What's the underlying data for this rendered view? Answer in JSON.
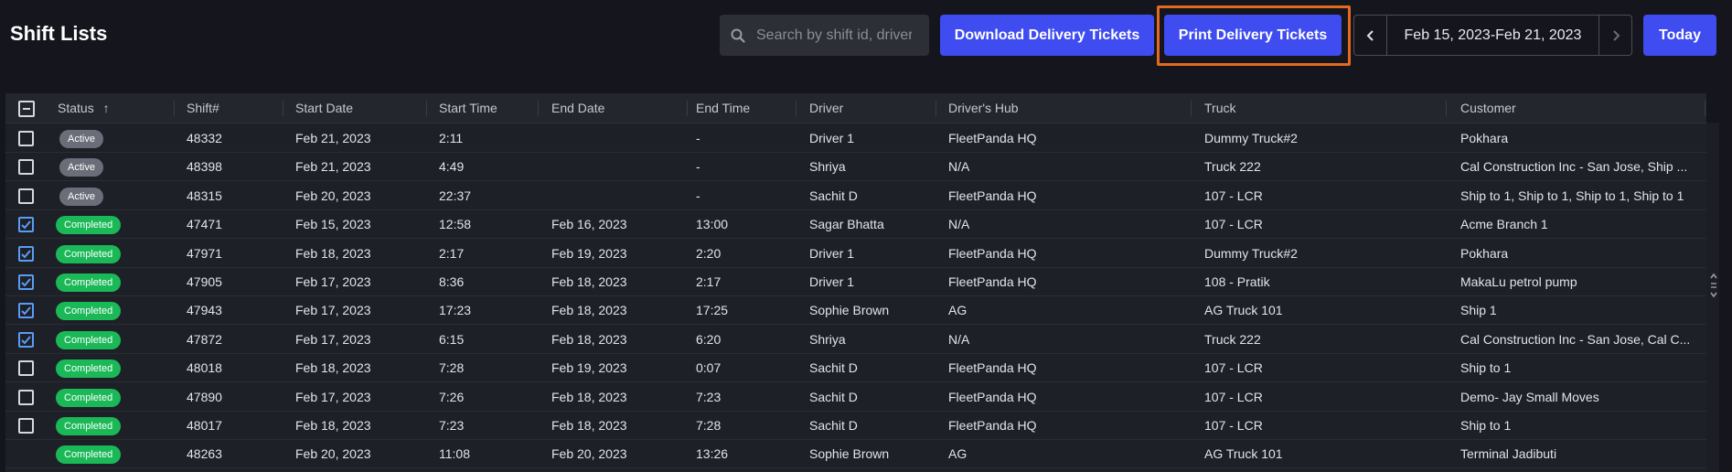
{
  "header": {
    "title": "Shift Lists",
    "search_placeholder": "Search by shift id, driver",
    "download_label": "Download Delivery Tickets",
    "print_label": "Print Delivery Tickets",
    "date_range": "Feb 15, 2023-Feb 21, 2023",
    "today_label": "Today"
  },
  "columns": [
    "Status",
    "Shift#",
    "Start Date",
    "Start Time",
    "End Date",
    "End Time",
    "Driver",
    "Driver's Hub",
    "Truck",
    "Customer"
  ],
  "sort_indicator": "↑",
  "colors": {
    "accent": "#3e4cf0",
    "highlight": "#e36a1f",
    "active_badge": "#6b6e78",
    "completed_badge": "#1bb858"
  },
  "rows": [
    {
      "checked": false,
      "status": "Active",
      "shift": "48332",
      "start_date": "Feb 21, 2023",
      "start_time": "2:11",
      "end_date": "",
      "end_time": "-",
      "driver": "Driver 1",
      "hub": "FleetPanda HQ",
      "truck": "Dummy Truck#2",
      "customer": "Pokhara"
    },
    {
      "checked": false,
      "status": "Active",
      "shift": "48398",
      "start_date": "Feb 21, 2023",
      "start_time": "4:49",
      "end_date": "",
      "end_time": "-",
      "driver": "Shriya",
      "hub": "N/A",
      "truck": "Truck 222",
      "customer": "Cal Construction Inc - San Jose, Ship ..."
    },
    {
      "checked": false,
      "status": "Active",
      "shift": "48315",
      "start_date": "Feb 20, 2023",
      "start_time": "22:37",
      "end_date": "",
      "end_time": "-",
      "driver": "Sachit D",
      "hub": "FleetPanda HQ",
      "truck": "107 - LCR",
      "customer": "Ship to 1, Ship to 1, Ship to 1, Ship to 1"
    },
    {
      "checked": true,
      "status": "Completed",
      "shift": "47471",
      "start_date": "Feb 15, 2023",
      "start_time": "12:58",
      "end_date": "Feb 16, 2023",
      "end_time": "13:00",
      "driver": "Sagar Bhatta",
      "hub": "N/A",
      "truck": "107 - LCR",
      "customer": "Acme Branch 1"
    },
    {
      "checked": true,
      "status": "Completed",
      "shift": "47971",
      "start_date": "Feb 18, 2023",
      "start_time": "2:17",
      "end_date": "Feb 19, 2023",
      "end_time": "2:20",
      "driver": "Driver 1",
      "hub": "FleetPanda HQ",
      "truck": "Dummy Truck#2",
      "customer": "Pokhara"
    },
    {
      "checked": true,
      "status": "Completed",
      "shift": "47905",
      "start_date": "Feb 17, 2023",
      "start_time": "8:36",
      "end_date": "Feb 18, 2023",
      "end_time": "2:17",
      "driver": "Driver 1",
      "hub": "FleetPanda HQ",
      "truck": "108 - Pratik",
      "customer": "MakaLu petrol pump"
    },
    {
      "checked": true,
      "status": "Completed",
      "shift": "47943",
      "start_date": "Feb 17, 2023",
      "start_time": "17:23",
      "end_date": "Feb 18, 2023",
      "end_time": "17:25",
      "driver": "Sophie Brown",
      "hub": "AG",
      "truck": "AG Truck 101",
      "customer": "Ship 1"
    },
    {
      "checked": true,
      "status": "Completed",
      "shift": "47872",
      "start_date": "Feb 17, 2023",
      "start_time": "6:15",
      "end_date": "Feb 18, 2023",
      "end_time": "6:20",
      "driver": "Shriya",
      "hub": "N/A",
      "truck": "Truck 222",
      "customer": "Cal Construction Inc - San Jose, Cal C..."
    },
    {
      "checked": false,
      "status": "Completed",
      "shift": "48018",
      "start_date": "Feb 18, 2023",
      "start_time": "7:28",
      "end_date": "Feb 19, 2023",
      "end_time": "0:07",
      "driver": "Sachit D",
      "hub": "FleetPanda HQ",
      "truck": "107 - LCR",
      "customer": "Ship to 1"
    },
    {
      "checked": false,
      "status": "Completed",
      "shift": "47890",
      "start_date": "Feb 17, 2023",
      "start_time": "7:26",
      "end_date": "Feb 18, 2023",
      "end_time": "7:23",
      "driver": "Sachit D",
      "hub": "FleetPanda HQ",
      "truck": "107 - LCR",
      "customer": "Demo- Jay Small Moves"
    },
    {
      "checked": false,
      "status": "Completed",
      "shift": "48017",
      "start_date": "Feb 18, 2023",
      "start_time": "7:23",
      "end_date": "Feb 18, 2023",
      "end_time": "7:28",
      "driver": "Sachit D",
      "hub": "FleetPanda HQ",
      "truck": "107 - LCR",
      "customer": "Ship to 1"
    },
    {
      "checked": null,
      "status": "Completed",
      "shift": "48263",
      "start_date": "Feb 20, 2023",
      "start_time": "11:08",
      "end_date": "Feb 20, 2023",
      "end_time": "13:26",
      "driver": "Sophie Brown",
      "hub": "AG",
      "truck": "AG Truck 101",
      "customer": "Terminal Jadibuti"
    }
  ]
}
